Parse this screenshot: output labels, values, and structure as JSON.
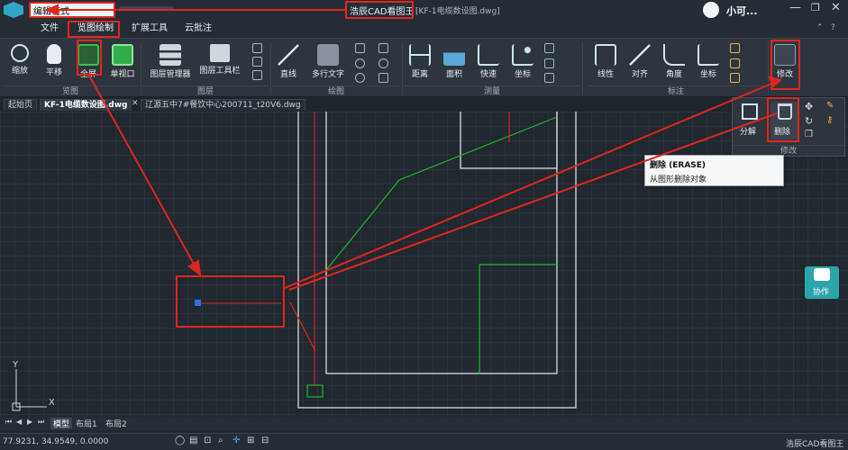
{
  "titlebar": {
    "mode_label": "编辑模式",
    "app_name": "浩辰CAD看图王",
    "file_name": "[KF-1电缆数设图.dwg]",
    "user_name": "小可..."
  },
  "menu": {
    "items": [
      {
        "label": "文件"
      },
      {
        "label": "览图绘制"
      },
      {
        "label": "扩展工具"
      },
      {
        "label": "云批注"
      }
    ]
  },
  "ribbon": {
    "view_tools": [
      {
        "label": "缩放"
      },
      {
        "label": "平移"
      },
      {
        "label": "全屏"
      },
      {
        "label": "单视口"
      }
    ],
    "layer_tools": [
      {
        "label": "图层管理器"
      },
      {
        "label": "图层工具栏"
      }
    ],
    "draw_tools": [
      {
        "label": "直线"
      },
      {
        "label": "多行文字"
      }
    ],
    "measure_tools": [
      {
        "label": "距离"
      },
      {
        "label": "面积"
      },
      {
        "label": "快速"
      },
      {
        "label": "坐标"
      }
    ],
    "annot_tools": [
      {
        "label": "线性"
      },
      {
        "label": "对齐"
      },
      {
        "label": "角度"
      },
      {
        "label": "坐标"
      }
    ],
    "modify_label": "修改",
    "groups": {
      "view": "览图",
      "layer": "图层",
      "draw": "绘图",
      "measure": "测量",
      "annot": "标注"
    }
  },
  "doc_tabs": [
    {
      "label": "起始页"
    },
    {
      "label": "KF-1电缆数设图.dwg"
    },
    {
      "label": "辽源五中7#餐饮中心200711_t20V6.dwg"
    }
  ],
  "modify_panel": {
    "explode": "分解",
    "erase": "删除",
    "group_label": "修改"
  },
  "tooltip": {
    "title": "删除 (ERASE)",
    "desc": "从图形删除对象"
  },
  "collab": {
    "label": "协作"
  },
  "layout_tabs": [
    {
      "label": "模型"
    },
    {
      "label": "布局1"
    },
    {
      "label": "布局2"
    }
  ],
  "status": {
    "coords": "77.9231, 34.9549, 0.0000",
    "app": "浩辰CAD看图王"
  },
  "axis": {
    "x": "X",
    "y": "Y"
  },
  "colors": {
    "accent_red": "#e0261f",
    "cad_green": "#1fb82a",
    "cad_white": "#e6e9ec",
    "cad_red": "#d42a2a",
    "collab_teal": "#2aa5a8"
  }
}
